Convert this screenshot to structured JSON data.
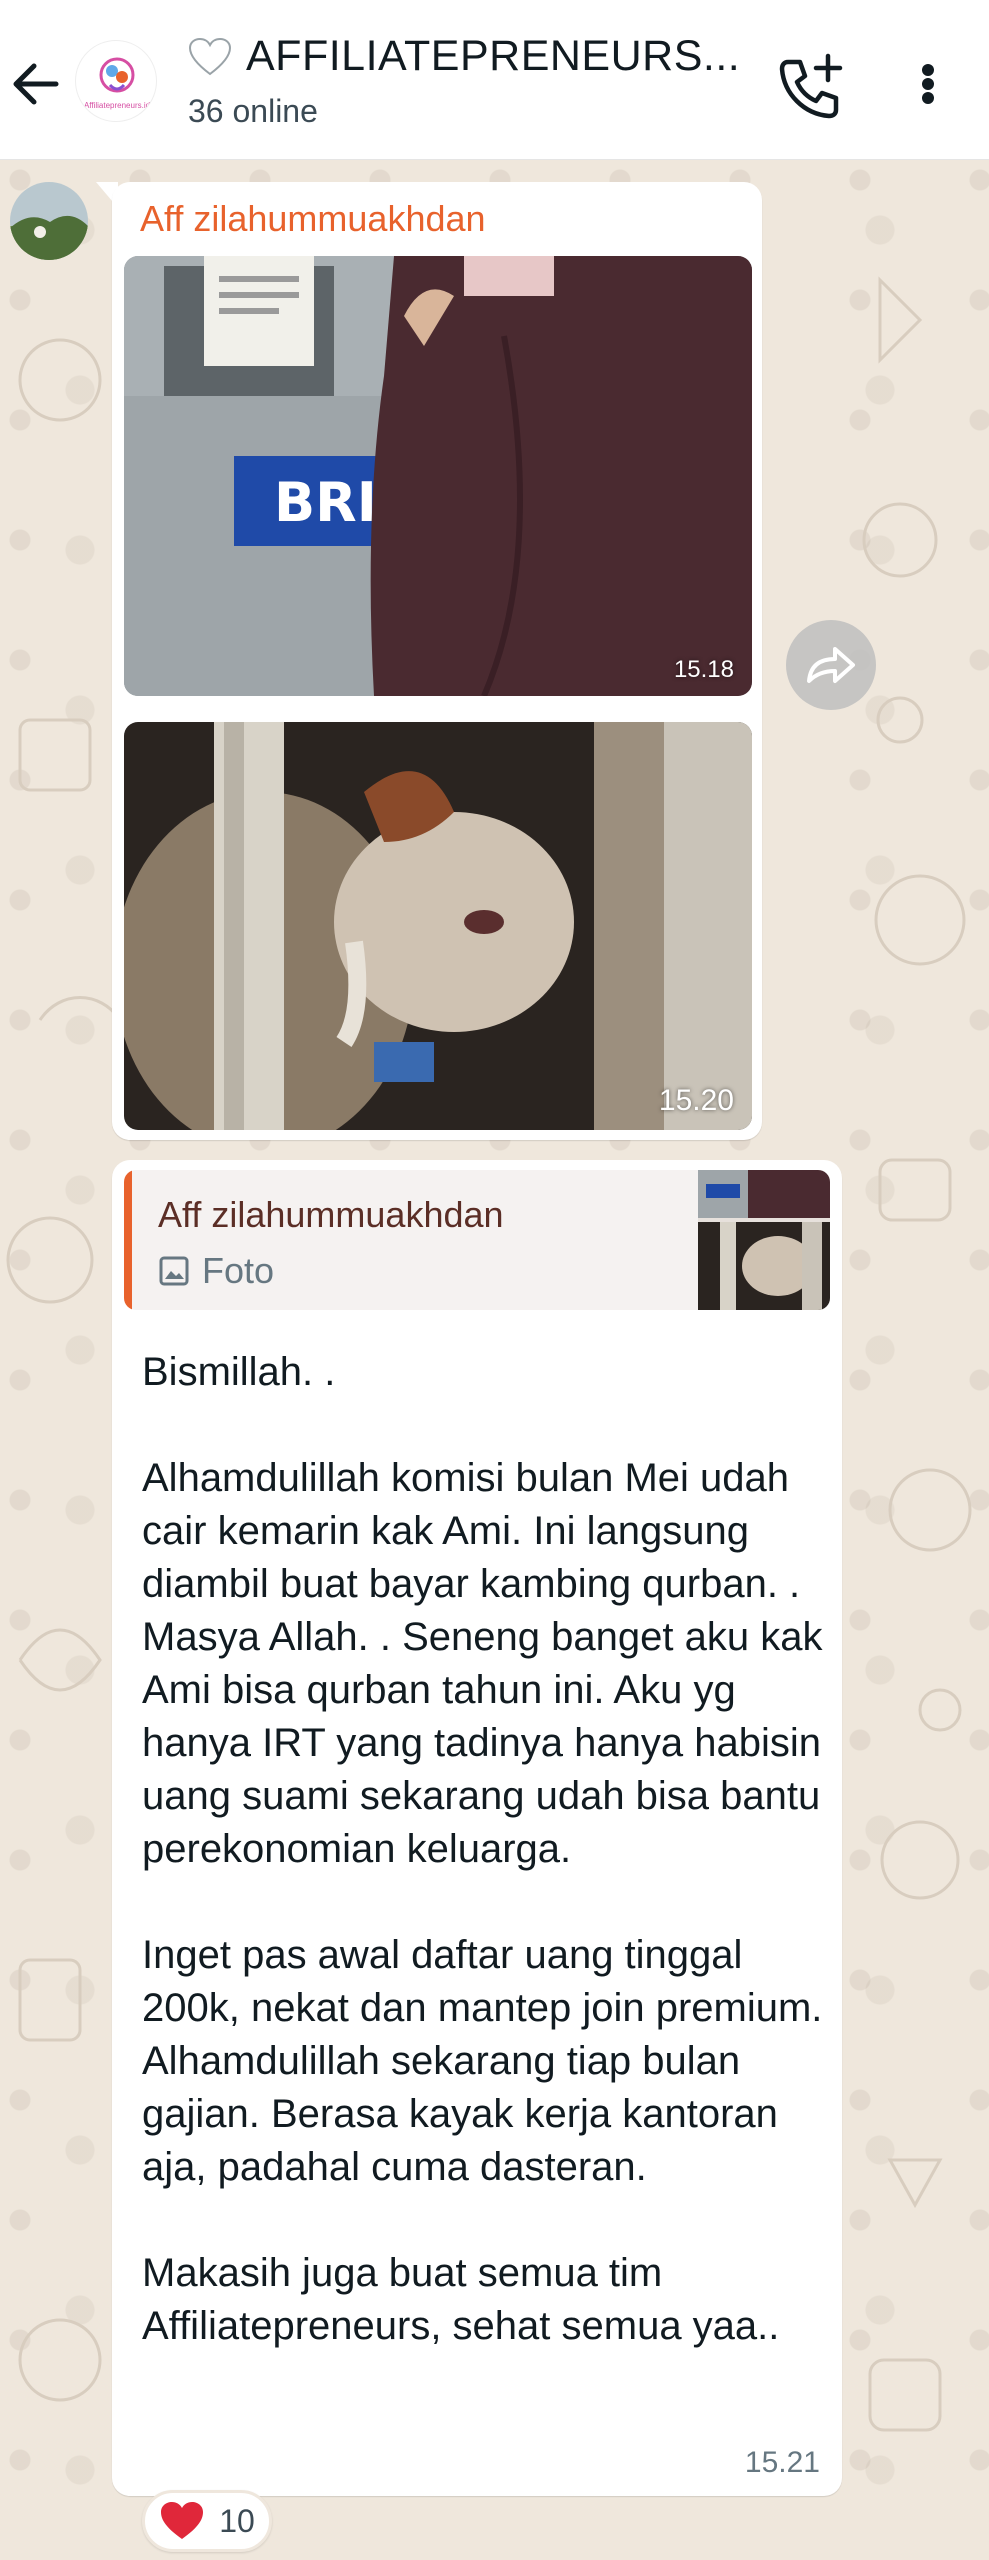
{
  "header": {
    "title": "AFFILIATEPRENEURS...",
    "status": "36 online",
    "group_logo_text": "Affiliatepreneurs.id"
  },
  "messages": [
    {
      "sender": "Aff zilahummuakhdan",
      "photos": [
        {
          "time": "15.18"
        },
        {
          "time": "15.20"
        }
      ]
    },
    {
      "quote": {
        "sender": "Aff zilahummuakhdan",
        "type": "Foto"
      },
      "text": "Bismillah. .\n\nAlhamdulillah komisi bulan Mei udah cair kemarin kak Ami. Ini langsung diambil buat bayar kambing qurban. . Masya Allah. . Seneng banget aku kak Ami bisa qurban tahun ini. Aku yg hanya IRT yang tadinya hanya habisin uang suami sekarang udah bisa bantu perekonomian keluarga.\n\nInget pas awal daftar uang tinggal 200k, nekat dan mantep join premium. Alhamdulillah sekarang tiap bulan gajian. Berasa kayak kerja kantoran aja, padahal cuma dasteran.\n\nMakasih juga buat semua tim Affiliatepreneurs, sehat semua yaa..",
      "time": "15.21",
      "reaction": {
        "emoji": "heart",
        "count": "10"
      }
    }
  ],
  "colors": {
    "sender_name": "#e8622c",
    "quote_bar": "#e8622c",
    "header_bg": "#ffffff",
    "chat_bg": "#efe7dd"
  }
}
